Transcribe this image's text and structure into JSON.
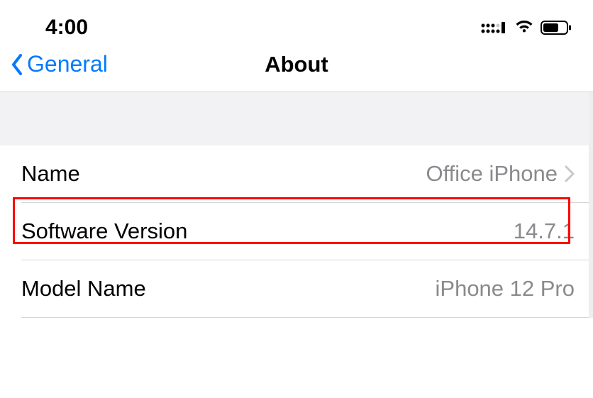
{
  "status_bar": {
    "time": "4:00"
  },
  "nav": {
    "back_label": "General",
    "title": "About"
  },
  "rows": [
    {
      "label": "Name",
      "value": "Office iPhone",
      "has_disclosure": true,
      "interactable": true
    },
    {
      "label": "Software Version",
      "value": "14.7.1",
      "has_disclosure": false,
      "interactable": false
    },
    {
      "label": "Model Name",
      "value": "iPhone 12 Pro",
      "has_disclosure": false,
      "interactable": false
    }
  ]
}
